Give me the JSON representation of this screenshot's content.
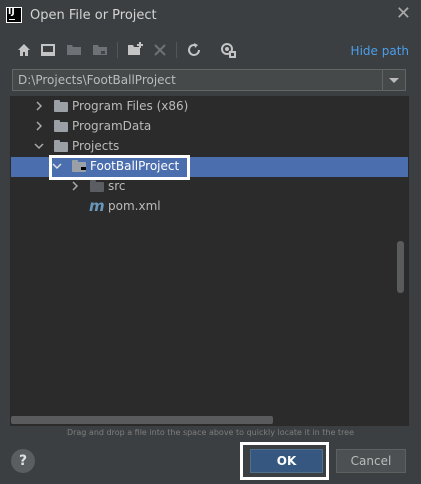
{
  "window": {
    "title": "Open File or Project",
    "close_icon": "close-icon"
  },
  "toolbar": {
    "icons": [
      "home-icon",
      "desktop-icon",
      "project-folder-icon",
      "module-folder-icon",
      "new-folder-icon",
      "delete-icon",
      "refresh-icon",
      "show-hidden-icon"
    ],
    "hide_path_label": "Hide path"
  },
  "path": {
    "value": "D:\\Projects\\FootBallProject"
  },
  "tree": {
    "items": [
      {
        "label": "Program Files (x86)"
      },
      {
        "label": "ProgramData"
      },
      {
        "label": "Projects"
      },
      {
        "label": "FootBallProject"
      },
      {
        "label": "src"
      },
      {
        "label": "pom.xml"
      }
    ]
  },
  "hint": "Drag and drop a file into the space above to quickly locate it in the tree",
  "buttons": {
    "help": "?",
    "ok": "OK",
    "cancel": "Cancel"
  },
  "colors": {
    "accent": "#4a9eed",
    "selection": "#4b6eaf",
    "ok_button": "#365880"
  }
}
